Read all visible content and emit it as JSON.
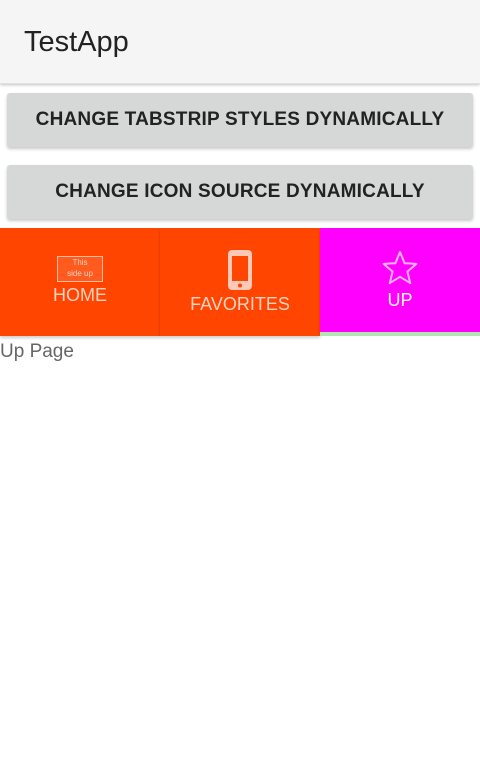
{
  "app_bar": {
    "title": "TestApp"
  },
  "buttons": {
    "change_tabstrip_styles": "CHANGE TABSTRIP STYLES DYNAMICALLY",
    "change_icon_source": "CHANGE ICON SOURCE DYNAMICALLY"
  },
  "tabstrip": {
    "selected_index": 2,
    "items": [
      {
        "label": "HOME",
        "icon": "image-icon",
        "icon_text": [
          "This",
          "side up"
        ]
      },
      {
        "label": "FAVORITES",
        "icon": "phone-icon"
      },
      {
        "label": "UP",
        "icon": "star-icon"
      }
    ],
    "colors": {
      "tab_background": "#ff4500",
      "selected_background": "#ff00ff",
      "selected_indicator": "#b6e3b4"
    }
  },
  "content": {
    "page_text": "Up Page"
  }
}
